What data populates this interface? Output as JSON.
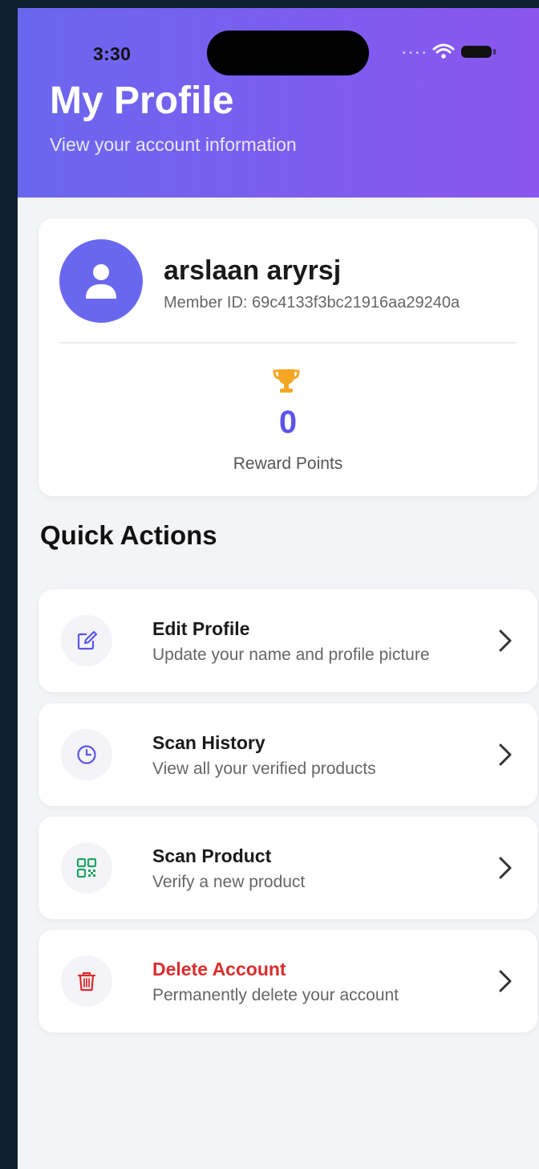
{
  "status_bar": {
    "time": "3:30",
    "signal_icon": "cellular-dots-icon",
    "wifi_icon": "wifi-icon",
    "battery_icon": "battery-icon"
  },
  "header": {
    "title": "My Profile",
    "subtitle": "View your account information",
    "gradient_start": "#6a67ef",
    "gradient_end": "#8a56ee"
  },
  "profile": {
    "name": "arslaan aryrsj",
    "member_id": "Member ID: 69c4133f3bc21916aa29240a",
    "avatar_icon": "user-icon",
    "reward_icon": "trophy-icon",
    "reward_points": "0",
    "reward_label": "Reward Points",
    "accent_color": "#5b55e8",
    "trophy_color": "#f5a623"
  },
  "quick_actions": {
    "title": "Quick Actions",
    "items": [
      {
        "title": "Edit Profile",
        "description": "Update your name and profile picture",
        "icon": "edit-icon",
        "color": "#5b55e8"
      },
      {
        "title": "Scan History",
        "description": "View all your verified products",
        "icon": "clock-icon",
        "color": "#5b55e8"
      },
      {
        "title": "Scan Product",
        "description": "Verify a new product",
        "icon": "qr-code-icon",
        "color": "#1fa463"
      },
      {
        "title": "Delete Account",
        "description": "Permanently delete your account",
        "icon": "trash-icon",
        "color": "#d92d2d"
      }
    ]
  }
}
